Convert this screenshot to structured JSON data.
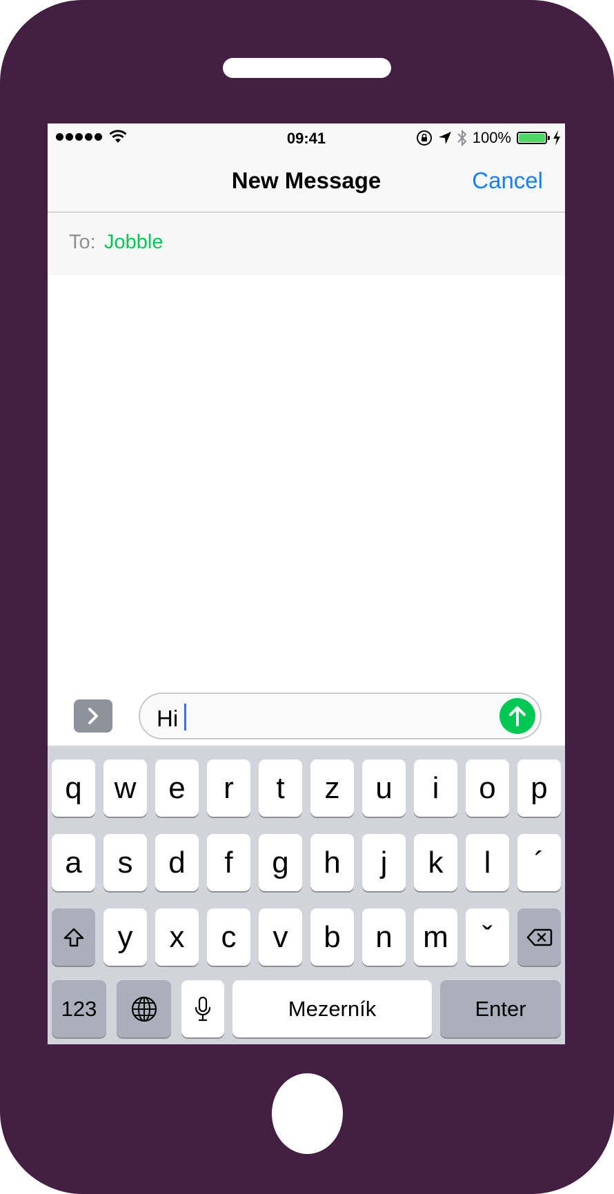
{
  "status_bar": {
    "time": "09:41",
    "battery_percent": "100%",
    "battery_level": 1.0
  },
  "nav": {
    "title": "New Message",
    "cancel_label": "Cancel"
  },
  "to_field": {
    "label": "To:",
    "recipient": "Jobble"
  },
  "compose": {
    "text": "Hi"
  },
  "keyboard": {
    "row1": [
      "q",
      "w",
      "e",
      "r",
      "t",
      "z",
      "u",
      "i",
      "o",
      "p"
    ],
    "row2": [
      "a",
      "s",
      "d",
      "f",
      "g",
      "h",
      "j",
      "k",
      "l",
      "´"
    ],
    "row3": [
      "y",
      "x",
      "c",
      "v",
      "b",
      "n",
      "m",
      "ˇ"
    ],
    "numbers_label": "123",
    "space_label": "Mezerník",
    "enter_label": "Enter"
  },
  "colors": {
    "frame": "#441f44",
    "accent_blue": "#147efb",
    "accent_green": "#00c853",
    "battery_green": "#4cd964",
    "keyboard_bg": "#d1d4db"
  },
  "icons": [
    "wifi-icon",
    "orientation-lock-icon",
    "location-icon",
    "bluetooth-icon",
    "battery-icon",
    "charging-icon",
    "chevron-right-icon",
    "send-arrow-icon",
    "shift-icon",
    "backspace-icon",
    "globe-icon",
    "microphone-icon"
  ]
}
